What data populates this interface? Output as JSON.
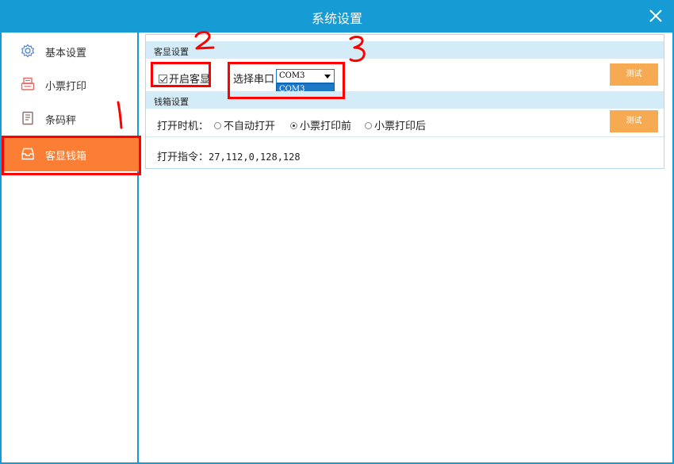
{
  "window": {
    "title": "系统设置"
  },
  "sidebar": {
    "items": [
      {
        "label": "基本设置",
        "icon": "gear-icon",
        "active": false
      },
      {
        "label": "小票打印",
        "icon": "printer-icon",
        "active": false
      },
      {
        "label": "条码秤",
        "icon": "scale-icon",
        "active": false
      },
      {
        "label": "客显钱箱",
        "icon": "cash-drawer-icon",
        "active": true
      }
    ]
  },
  "customer_display": {
    "section_title": "客显设置",
    "enable_label": "开启客显",
    "enable_checked": true,
    "port_label": "选择串口",
    "port_value": "COM3",
    "port_options": [
      "COM3"
    ],
    "test_label": "测试"
  },
  "cash_drawer": {
    "section_title": "钱箱设置",
    "timing_label": "打开时机：",
    "options": [
      "不自动打开",
      "小票打印前",
      "小票打印后"
    ],
    "selected_option": "小票打印前",
    "command_label": "打开指令：",
    "command_value": "27,112,0,128,128",
    "test_label": "测试"
  },
  "annotations": {
    "labels": [
      "1",
      "2",
      "3"
    ],
    "color": "#ff0000"
  },
  "colors": {
    "titlebar": "#169bd5",
    "active_item": "#fc7e35",
    "button": "#f6ab53",
    "section_header": "#d4ecf8"
  }
}
